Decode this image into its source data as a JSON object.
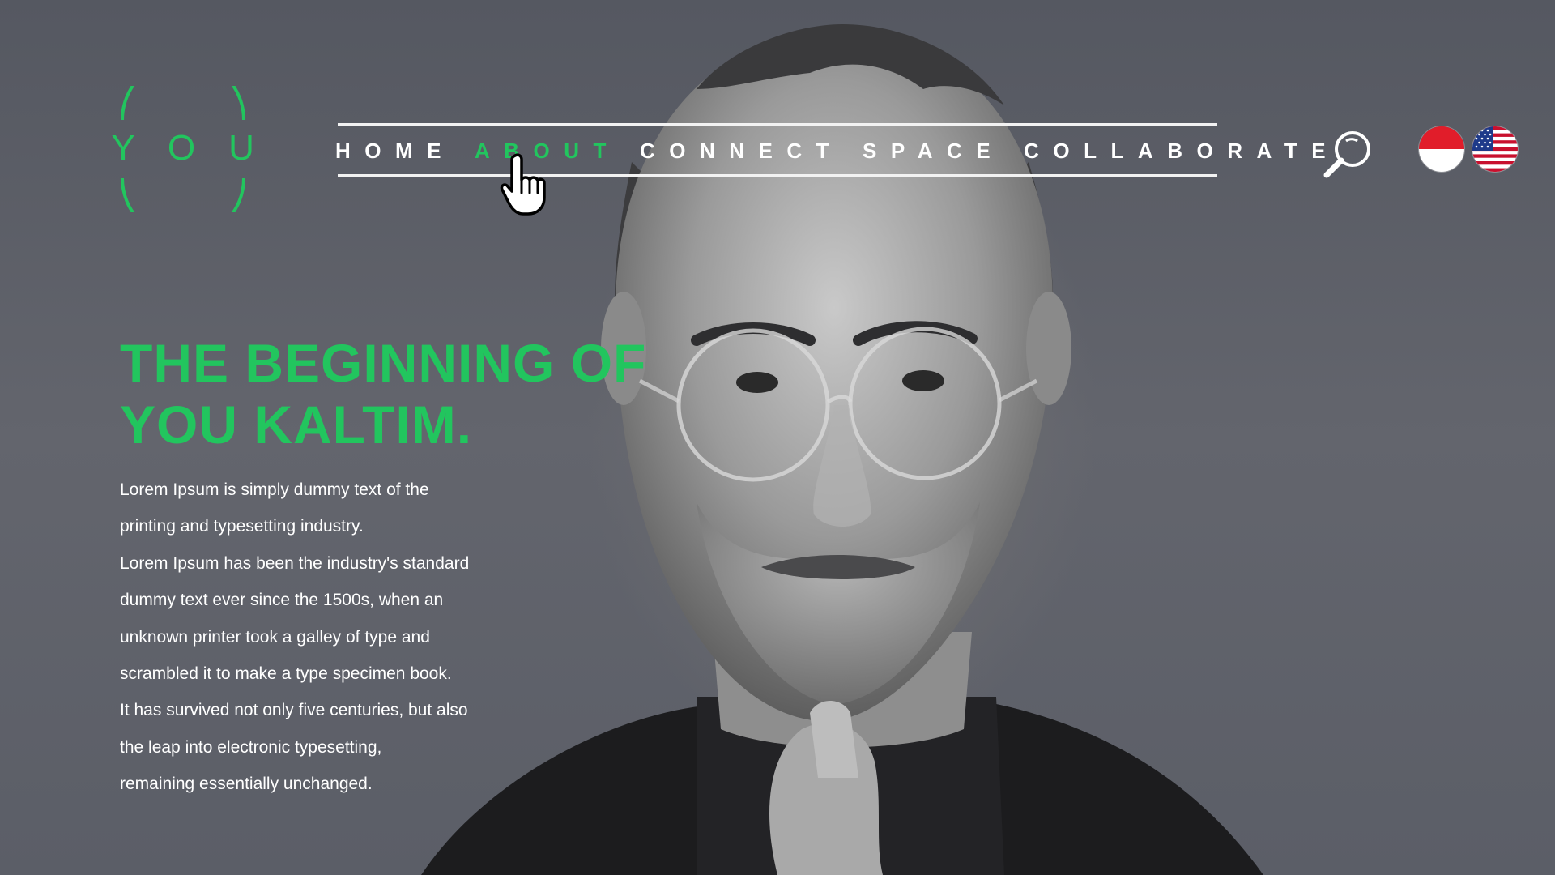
{
  "logo": {
    "letters": [
      "Y",
      "O",
      "U"
    ],
    "color": "#22c55e"
  },
  "nav": {
    "items": [
      {
        "label": "HOME",
        "active": false
      },
      {
        "label": "ABOUT",
        "active": true
      },
      {
        "label": "CONNECT",
        "active": false
      },
      {
        "label": "SPACE",
        "active": false
      },
      {
        "label": "COLLABORATE",
        "active": false
      }
    ]
  },
  "icons": {
    "search": "search-icon",
    "cursor": "hand-pointer-cursor-icon",
    "flag_id": "indonesia-flag-icon",
    "flag_en": "usa-flag-icon"
  },
  "hero": {
    "headline_line1": "THE BEGINNING OF",
    "headline_line2": "YOU KALTIM.",
    "paragraph_lines": [
      "Lorem Ipsum is simply dummy text of the",
      "printing and typesetting industry.",
      "Lorem Ipsum has been the industry's standard",
      "dummy text ever since the 1500s, when an",
      "unknown printer took a galley of type and",
      "scrambled it to make a type specimen book.",
      "It has survived not only five centuries, but also",
      "the leap into electronic typesetting,",
      "remaining essentially unchanged."
    ]
  },
  "colors": {
    "accent": "#22c55e",
    "background": "#5a5d66",
    "text": "#ffffff"
  }
}
